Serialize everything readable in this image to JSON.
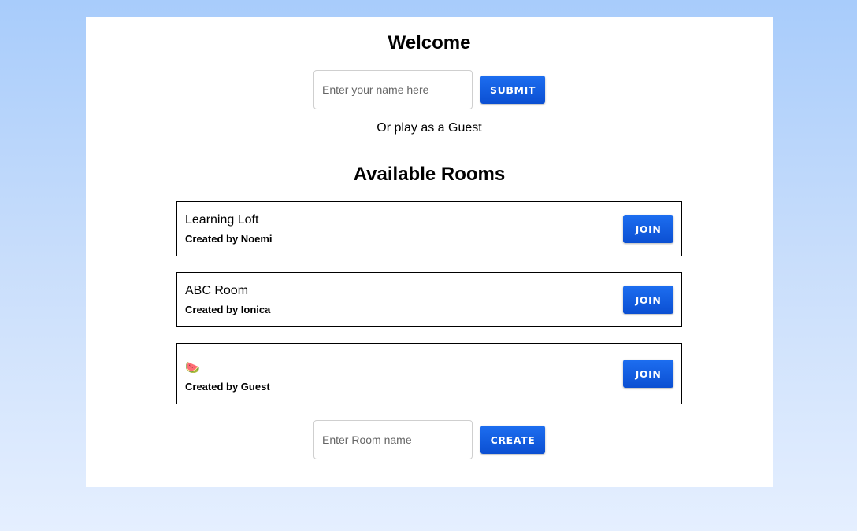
{
  "welcome": {
    "title": "Welcome",
    "name_placeholder": "Enter your name here",
    "submit_label": "SUBMIT",
    "guest_text": "Or play as a Guest"
  },
  "rooms": {
    "title": "Available Rooms",
    "items": [
      {
        "name": "Learning Loft",
        "creator": "Created by Noemi",
        "join_label": "JOIN"
      },
      {
        "name": "ABC Room",
        "creator": "Created by Ionica",
        "join_label": "JOIN"
      },
      {
        "name": "🍉",
        "creator": "Created by Guest",
        "join_label": "JOIN"
      }
    ]
  },
  "create": {
    "placeholder": "Enter Room name",
    "button_label": "CREATE"
  },
  "colors": {
    "accent": "#0f5ce0",
    "background_top": "#a8ccfb",
    "background_bottom": "#e5efff"
  }
}
